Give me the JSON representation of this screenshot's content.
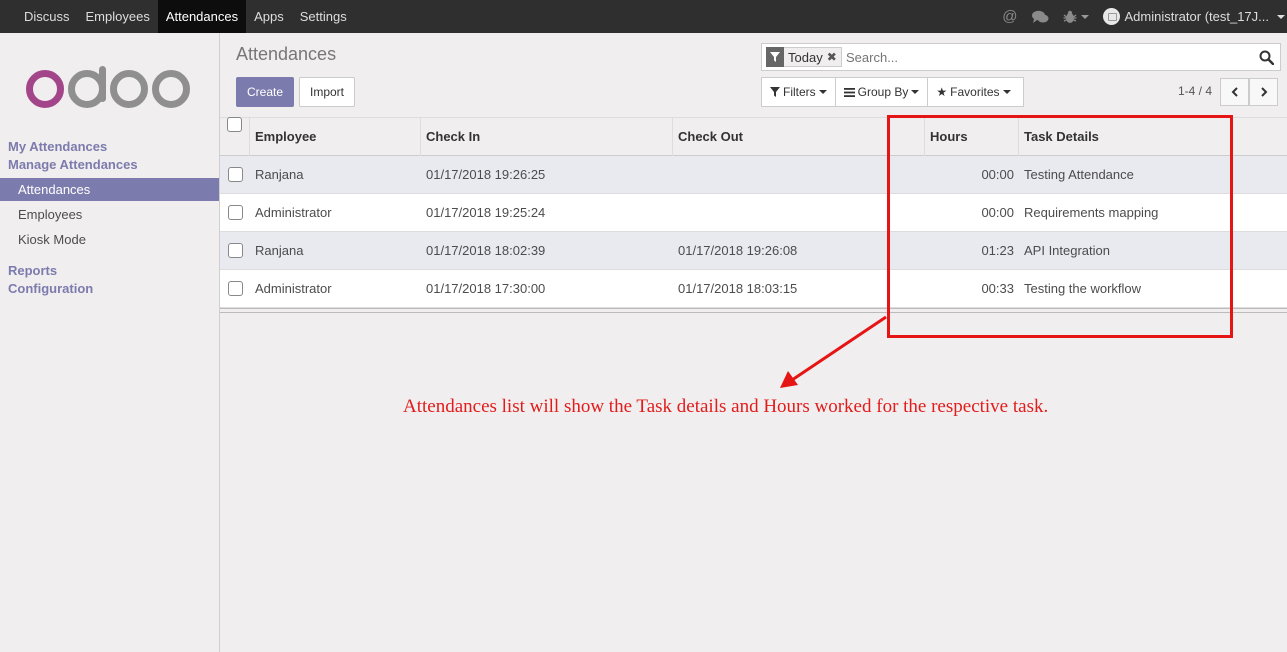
{
  "navbar": {
    "menu": [
      "Discuss",
      "Employees",
      "Attendances",
      "Apps",
      "Settings"
    ],
    "active": "Attendances",
    "user": "Administrator (test_17J..."
  },
  "sidebar": {
    "logo_text": "odoo",
    "sections": [
      {
        "label": "My Attendances"
      },
      {
        "label": "Manage Attendances",
        "items": [
          "Attendances",
          "Employees",
          "Kiosk Mode"
        ]
      },
      {
        "label": "Reports"
      },
      {
        "label": "Configuration"
      }
    ]
  },
  "control": {
    "title": "Attendances",
    "create_label": "Create",
    "import_label": "Import",
    "facet_label": "Today",
    "search_placeholder": "Search...",
    "filters_label": "Filters",
    "groupby_label": "Group By",
    "favorites_label": "Favorites",
    "pager": "1-4 / 4"
  },
  "table": {
    "columns": [
      "Employee",
      "Check In",
      "Check Out",
      "Hours",
      "Task Details"
    ],
    "rows": [
      {
        "employee": "Ranjana",
        "check_in": "01/17/2018 19:26:25",
        "check_out": "",
        "hours": "00:00",
        "task": "Testing Attendance"
      },
      {
        "employee": "Administrator",
        "check_in": "01/17/2018 19:25:24",
        "check_out": "",
        "hours": "00:00",
        "task": "Requirements mapping"
      },
      {
        "employee": "Ranjana",
        "check_in": "01/17/2018 18:02:39",
        "check_out": "01/17/2018 19:26:08",
        "hours": "01:23",
        "task": "API Integration"
      },
      {
        "employee": "Administrator",
        "check_in": "01/17/2018 17:30:00",
        "check_out": "01/17/2018 18:03:15",
        "hours": "00:33",
        "task": "Testing the workflow"
      }
    ]
  },
  "annotation": {
    "text": "Attendances list will show the Task details and Hours worked for the respective task.",
    "color": "#e21c1c"
  },
  "colors": {
    "brand": "#7c7bad",
    "navbar": "#2f2f2f",
    "logo_o": "#a24689",
    "logo_rest": "#8f8f8f"
  }
}
